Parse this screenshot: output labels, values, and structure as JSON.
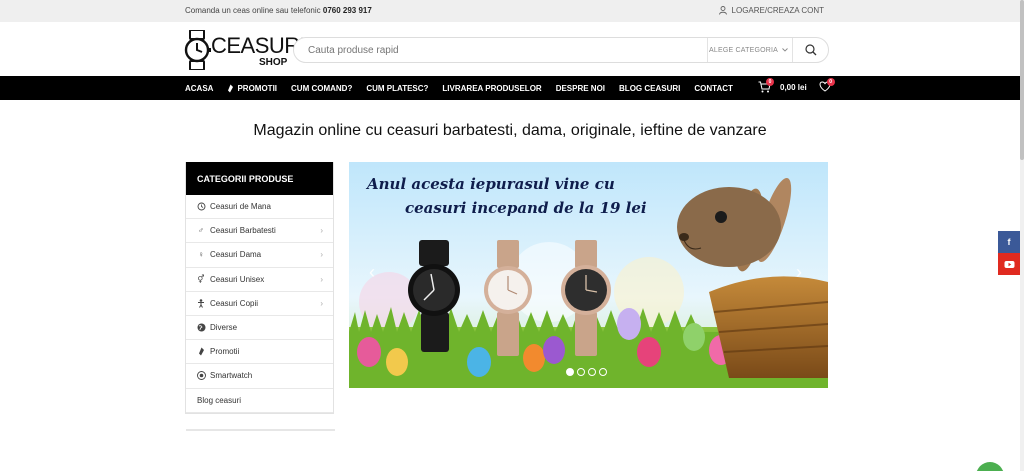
{
  "topbar": {
    "phone_text": "Comanda un ceas online sau telefonic",
    "phone_number": "0760 293 917",
    "account_link": "LOGARE/CREAZA CONT",
    "account_icon": "user-icon"
  },
  "header": {
    "logo_word": "CEASURI",
    "logo_sub": "SHOP",
    "search_placeholder": "Cauta produse rapid",
    "category_select": "ALEGE CATEGORIA",
    "search_icon": "search-icon"
  },
  "nav": {
    "items": [
      {
        "label": "ACASA"
      },
      {
        "label": "PROMOTII",
        "icon": "tag-icon"
      },
      {
        "label": "CUM COMAND?"
      },
      {
        "label": "CUM PLATESC?"
      },
      {
        "label": "LIVRAREA PRODUSELOR"
      },
      {
        "label": "DESPRE NOI"
      },
      {
        "label": "BLOG CEASURI"
      },
      {
        "label": "CONTACT"
      }
    ],
    "cart_count": "0",
    "cart_total": "0,00 lei",
    "wishlist_count": "0"
  },
  "headline": "Magazin online cu ceasuri barbatesti, dama, originale, ieftine de vanzare",
  "sidebar": {
    "title": "CATEGORII PRODUSE",
    "items": [
      {
        "label": "Ceasuri de Mana",
        "icon": "watch-icon",
        "has_sub": false
      },
      {
        "label": "Ceasuri Barbatesti",
        "icon": "male-icon",
        "has_sub": true
      },
      {
        "label": "Ceasuri Dama",
        "icon": "female-icon",
        "has_sub": true
      },
      {
        "label": "Ceasuri Unisex",
        "icon": "unisex-icon",
        "has_sub": true
      },
      {
        "label": "Ceasuri Copii",
        "icon": "child-icon",
        "has_sub": true
      },
      {
        "label": "Diverse",
        "icon": "globe-icon",
        "has_sub": false
      },
      {
        "label": "Promotii",
        "icon": "tag-icon",
        "has_sub": false
      },
      {
        "label": "Smartwatch",
        "icon": "smartwatch-icon",
        "has_sub": false
      },
      {
        "label": "Blog ceasuri",
        "icon": "",
        "has_sub": false
      }
    ]
  },
  "banner": {
    "line1": "Anul acesta iepurasul vine cu",
    "line2": "ceasuri incepand de la 19 lei",
    "slides": 4,
    "active_slide": 1
  },
  "social": {
    "facebook": "f",
    "youtube": "You Tube"
  },
  "colors": {
    "nav_bg": "#000000",
    "badge": "#e8334a",
    "facebook": "#3b5998",
    "youtube": "#e02a20"
  }
}
